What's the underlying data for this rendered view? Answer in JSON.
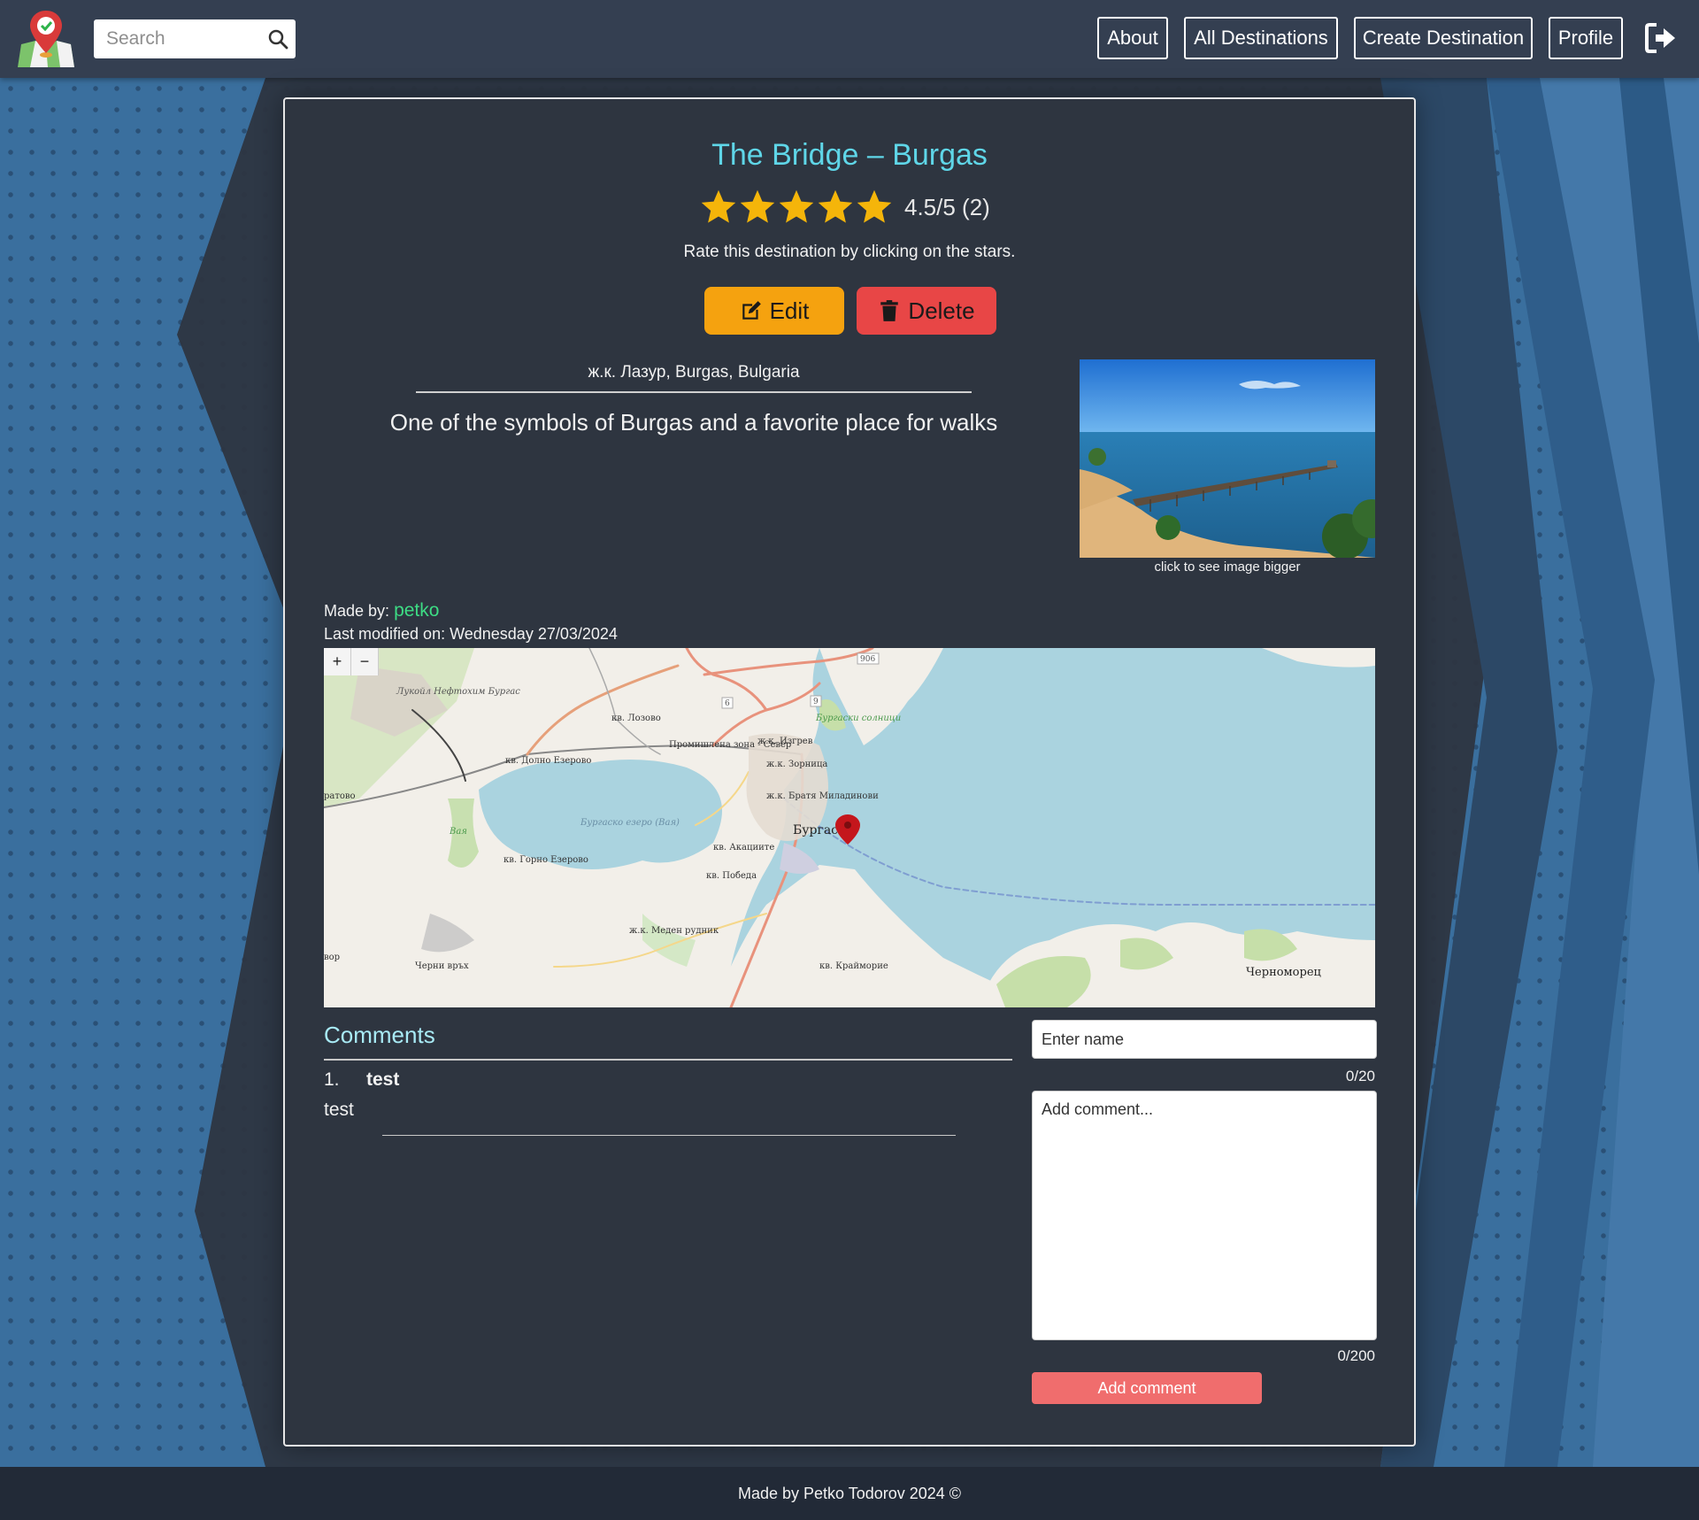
{
  "navbar": {
    "search_placeholder": "Search",
    "links": [
      "About",
      "All Destinations",
      "Create Destination",
      "Profile"
    ]
  },
  "destination": {
    "title": "The Bridge – Burgas",
    "rating": 4.5,
    "rating_text": "4.5/5 (2)",
    "rate_hint": "Rate this destination by clicking on the stars.",
    "edit_label": "Edit",
    "delete_label": "Delete",
    "address": "ж.к. Лазур, Burgas, Bulgaria",
    "description": "One of the symbols of Burgas and a favorite place for walks",
    "image_caption": "click to see image bigger",
    "made_by_label": "Made by:",
    "author": "petko",
    "last_modified": "Last modified on: Wednesday 27/03/2024"
  },
  "map": {
    "zoom_in": "+",
    "zoom_out": "−",
    "labels": {
      "lukoil": "Лукойл Нефтохим Бургас",
      "lozovo": "кв. Лозово",
      "industrial": "Промишлена зона - Север",
      "izgrev": "ж.к. Изгрев",
      "zornitsa": "ж.к. Зорница",
      "dolno_ezerovo": "кв. Долно Езерово",
      "bratya": "ж.к. Братя Миладинови",
      "burgas": "Бургас",
      "lake": "Бургаско езеро (Вая)",
      "akatsiite": "кв. Акациите",
      "gorno_ezerovo": "кв. Горно Езерово",
      "pobeda": "кв. Победа",
      "meden_rudnik": "ж.к. Меден рудник",
      "cherni_vrah": "Черни връх",
      "kraimorie": "кв. Крайморие",
      "chernomorets": "Черноморец",
      "salt_pans": "Бургаски солници",
      "vaya": "Вая",
      "road_906": "906",
      "road_6": "6",
      "road_9": "9",
      "ratovo": "ратово",
      "vor": "вор"
    }
  },
  "comments": {
    "title": "Comments",
    "items": [
      {
        "number": "1.",
        "author": "test",
        "text": "test"
      }
    ],
    "name_placeholder": "Enter name",
    "name_count": "0/20",
    "comment_placeholder": "Add comment...",
    "comment_count": "0/200",
    "add_label": "Add comment"
  },
  "footer": {
    "text": "Made by Petko Todorov 2024 ©"
  },
  "colors": {
    "title": "#5fd6e8",
    "star": "#f5b50a",
    "edit": "#f5a20f",
    "delete": "#e84646",
    "author": "#3ddc84",
    "add_comment": "#f06d6d"
  }
}
